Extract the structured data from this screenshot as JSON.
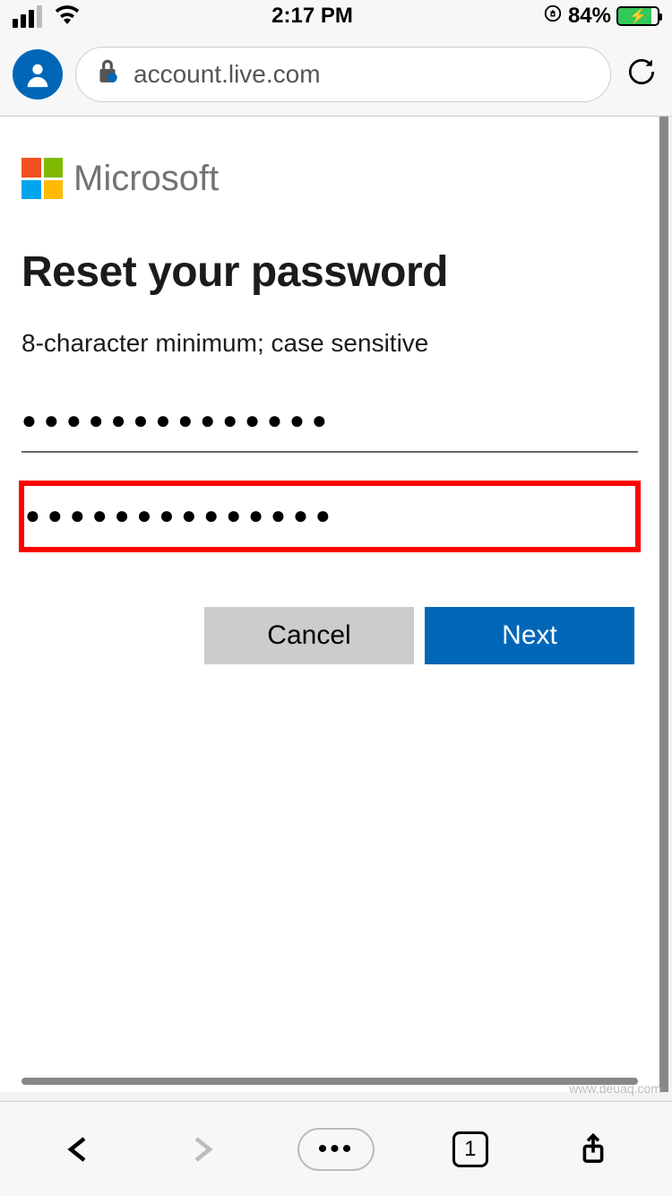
{
  "status_bar": {
    "time": "2:17 PM",
    "battery_percent": "84%"
  },
  "browser": {
    "url_display": "account.live.com",
    "tab_count": "1"
  },
  "page": {
    "brand": "Microsoft",
    "title": "Reset your password",
    "hint": "8-character minimum; case sensitive",
    "password_value": "●●●●●●●●●●●●●●",
    "confirm_value": "●●●●●●●●●●●●●●",
    "cancel_label": "Cancel",
    "next_label": "Next"
  },
  "watermark": "www.deuaq.com"
}
